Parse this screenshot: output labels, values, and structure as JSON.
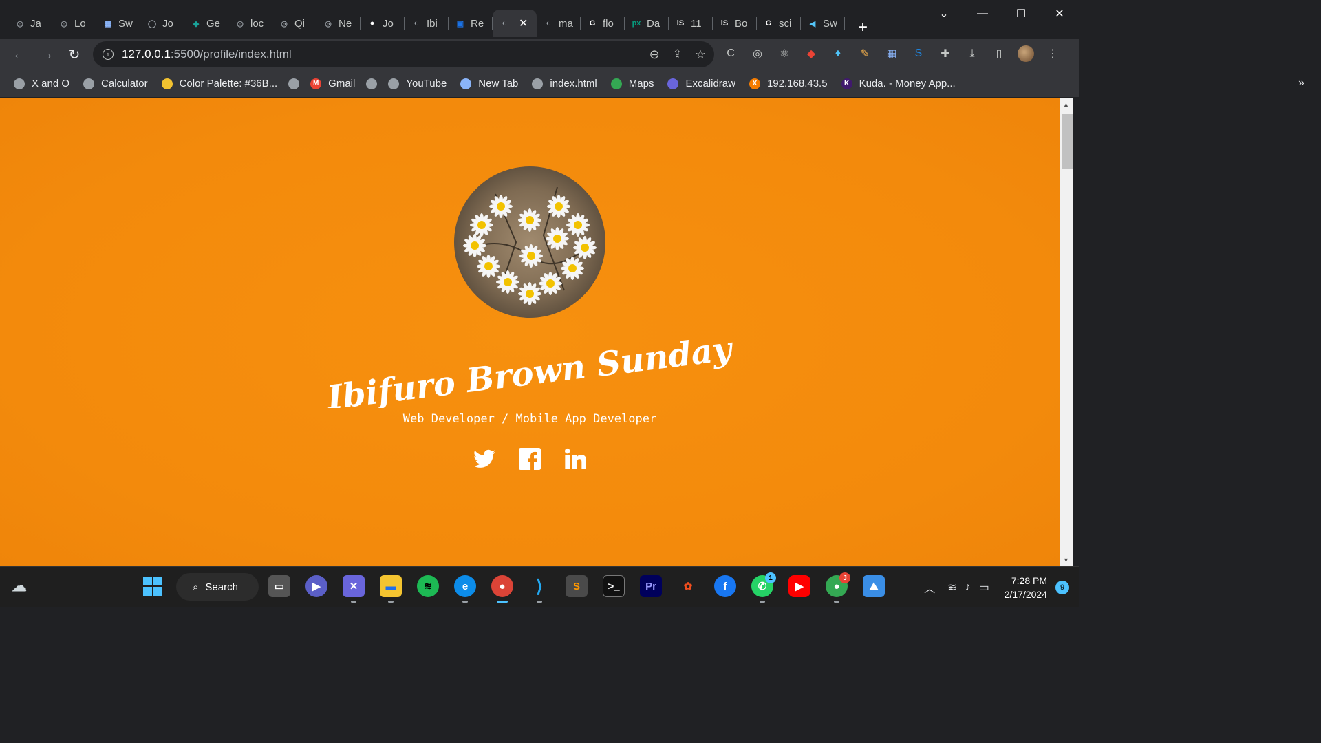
{
  "tabs": [
    {
      "label": "Ja",
      "fav_color": "#9aa0a6",
      "fav_text": "◎"
    },
    {
      "label": "Lo",
      "fav_color": "#9aa0a6",
      "fav_text": "◎"
    },
    {
      "label": "Sw",
      "fav_color": "#8ab4f8",
      "fav_text": "▦"
    },
    {
      "label": "Jo",
      "fav_color": "#9aa0a6",
      "fav_text": "◯"
    },
    {
      "label": "Ge",
      "fav_color": "#1aa39a",
      "fav_text": "◆"
    },
    {
      "label": "loc",
      "fav_color": "#9aa0a6",
      "fav_text": "◎"
    },
    {
      "label": "Qi",
      "fav_color": "#9aa0a6",
      "fav_text": "◎"
    },
    {
      "label": "Ne",
      "fav_color": "#9aa0a6",
      "fav_text": "◎"
    },
    {
      "label": "Jo",
      "fav_color": "#ffffff",
      "fav_text": "●"
    },
    {
      "label": "Ibi",
      "fav_color": "#9aa0a6",
      "fav_text": "◐"
    },
    {
      "label": "Re",
      "fav_color": "#1a73e8",
      "fav_text": "▣"
    },
    {
      "label": "",
      "fav_color": "#9aa0a6",
      "fav_text": "◐",
      "active": true
    },
    {
      "label": "ma",
      "fav_color": "#9aa0a6",
      "fav_text": "◐"
    },
    {
      "label": "flo",
      "fav_color": "#ffffff",
      "fav_text": "G"
    },
    {
      "label": "Da",
      "fav_color": "#05a081",
      "fav_text": "px"
    },
    {
      "label": "11",
      "fav_color": "#ffffff",
      "fav_text": "iS"
    },
    {
      "label": "Bo",
      "fav_color": "#ffffff",
      "fav_text": "iS"
    },
    {
      "label": "sci",
      "fav_color": "#ffffff",
      "fav_text": "G"
    },
    {
      "label": "Sw",
      "fav_color": "#54c5f8",
      "fav_text": "◀"
    }
  ],
  "address": {
    "host": "127.0.0.1",
    "path": ":5500/profile/index.html"
  },
  "bookmarks": [
    {
      "label": "X and O",
      "fav_color": "#9aa0a6",
      "fav_text": ""
    },
    {
      "label": "Calculator",
      "fav_color": "#9aa0a6",
      "fav_text": ""
    },
    {
      "label": "Color Palette: #36B...",
      "fav_color": "#f2c230",
      "fav_text": ""
    },
    {
      "label": "",
      "fav_color": "#9aa0a6",
      "fav_text": ""
    },
    {
      "label": "Gmail",
      "fav_color": "#ea4335",
      "fav_text": "M"
    },
    {
      "label": "",
      "fav_color": "#9aa0a6",
      "fav_text": ""
    },
    {
      "label": "YouTube",
      "fav_color": "#9aa0a6",
      "fav_text": ""
    },
    {
      "label": "New Tab",
      "fav_color": "#8ab4f8",
      "fav_text": ""
    },
    {
      "label": "index.html",
      "fav_color": "#9aa0a6",
      "fav_text": ""
    },
    {
      "label": "Maps",
      "fav_color": "#34a853",
      "fav_text": ""
    },
    {
      "label": "Excalidraw",
      "fav_color": "#6965db",
      "fav_text": ""
    },
    {
      "label": "192.168.43.5",
      "fav_color": "#f57c00",
      "fav_text": "X"
    },
    {
      "label": "Kuda. - Money App...",
      "fav_color": "#40196d",
      "fav_text": "K"
    }
  ],
  "page": {
    "name": "— Ibifuro Brown Sunday —",
    "role": "Web Developer / Mobile App Developer",
    "background_color": "#f38a0c"
  },
  "taskbar": {
    "search_label": "Search",
    "time": "7:28 PM",
    "date": "2/17/2024",
    "notification_count": "9",
    "whatsapp_badge": "1",
    "chrome_badge": "J"
  }
}
